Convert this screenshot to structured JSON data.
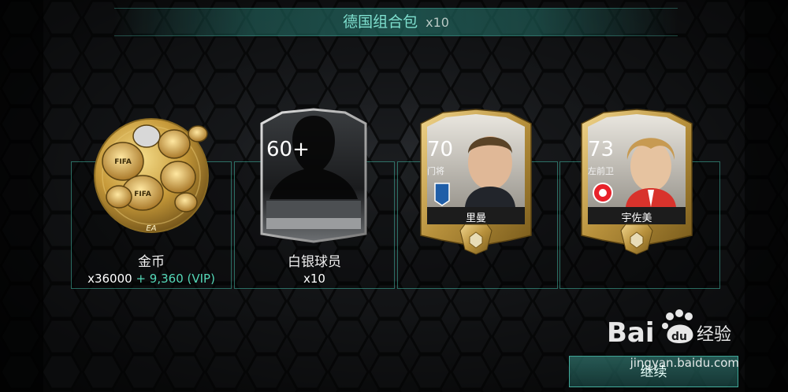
{
  "header": {
    "title": "德国组合包",
    "quantity": "x10"
  },
  "items": [
    {
      "label": "金币",
      "amount": "x36000",
      "bonus": "+ 9,360 (VIP)"
    },
    {
      "label": "白银球员",
      "amount": "x10",
      "card_rating": "60+"
    },
    {
      "card_rating": "70",
      "card_position": "门将",
      "card_name": "里曼"
    },
    {
      "card_rating": "73",
      "card_position": "左前卫",
      "card_name": "宇佐美"
    }
  ],
  "footer": {
    "continue_label": "继续"
  },
  "watermark": {
    "logo": "Bai du 经验",
    "url": "jingyan.baidu.com"
  },
  "colors": {
    "accent": "#55d8b8",
    "gold": "#c9a24a",
    "title": "#7fe0cf"
  }
}
